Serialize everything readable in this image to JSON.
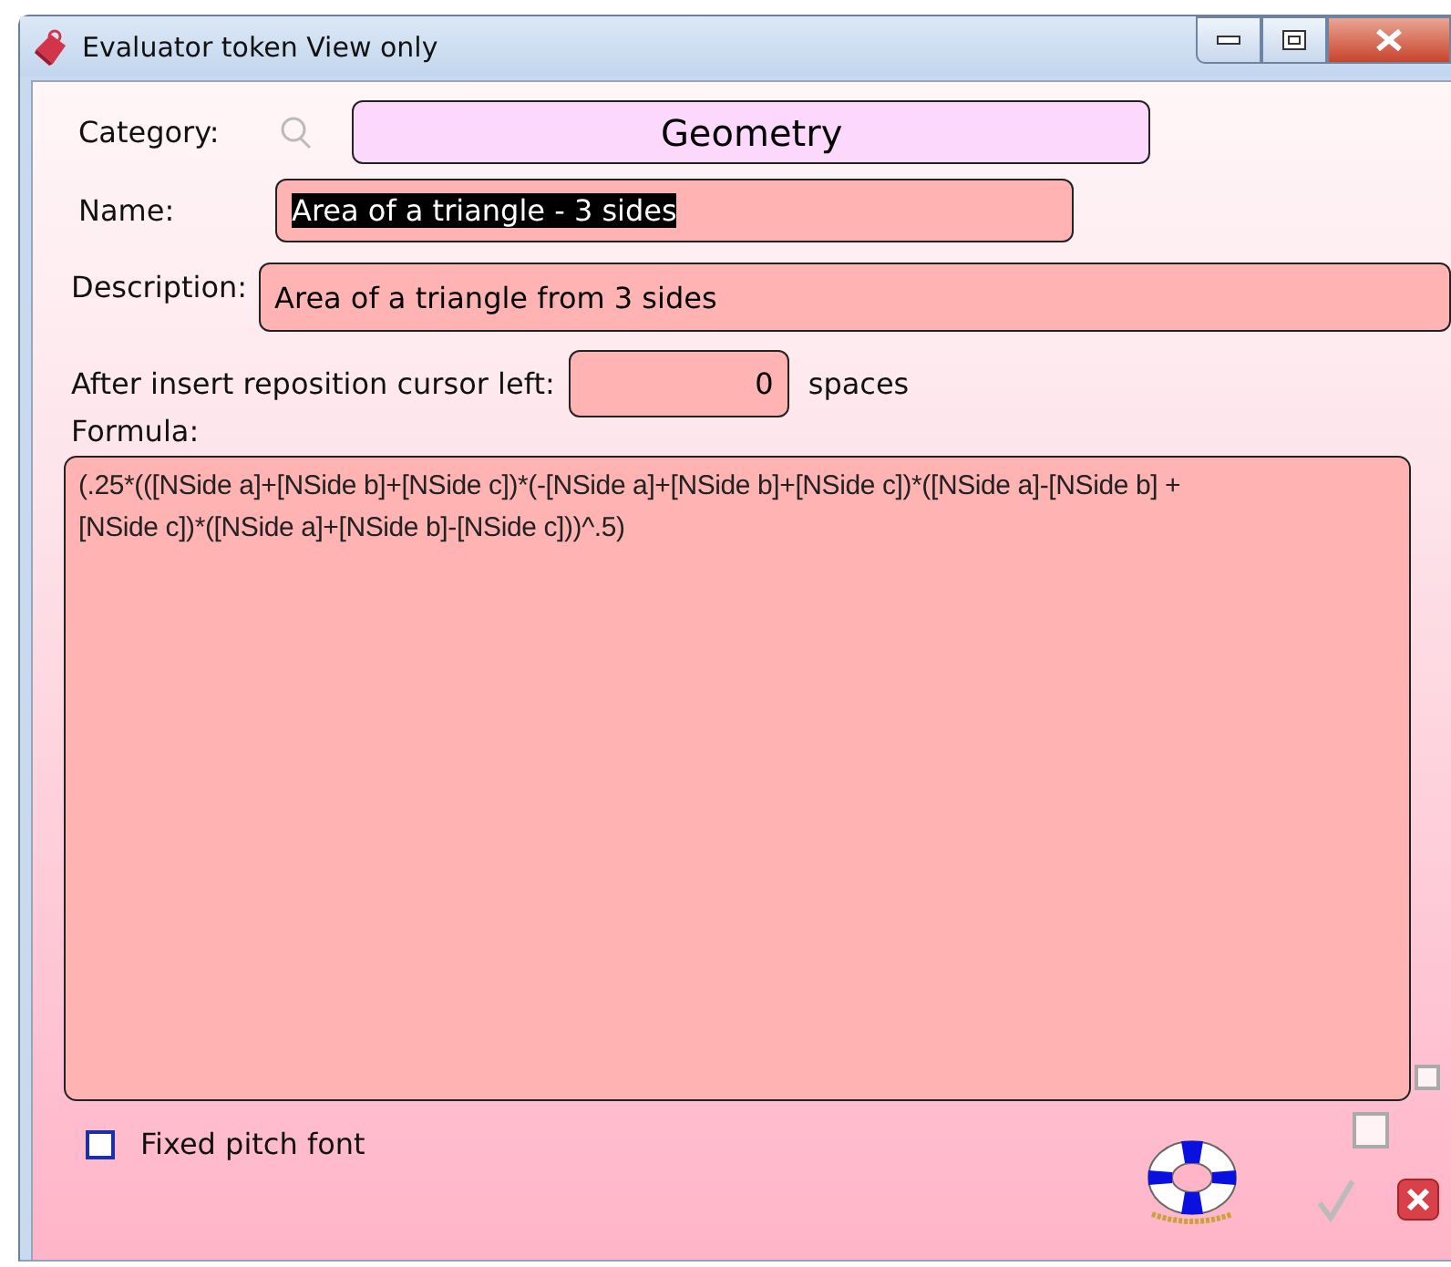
{
  "window": {
    "title": "Evaluator token View only"
  },
  "category": {
    "label": "Category:",
    "value": "Geometry"
  },
  "name": {
    "label": "Name:",
    "value": "Area of a triangle - 3 sides",
    "text_selected": true
  },
  "description": {
    "label": "Description:",
    "value": "Area of a triangle from 3 sides"
  },
  "reposition": {
    "label": "After insert reposition cursor left:",
    "value": "0",
    "unit": "spaces"
  },
  "formula": {
    "label": "Formula:",
    "value": "(.25*(([NSide a]+[NSide b]+[NSide c])*(-[NSide a]+[NSide b]+[NSide c])*([NSide a]-[NSide b] +[NSide c])*([NSide a]+[NSide b]-[NSide c]))^.5)"
  },
  "fixed_pitch": {
    "label": "Fixed pitch font",
    "checked": false
  }
}
